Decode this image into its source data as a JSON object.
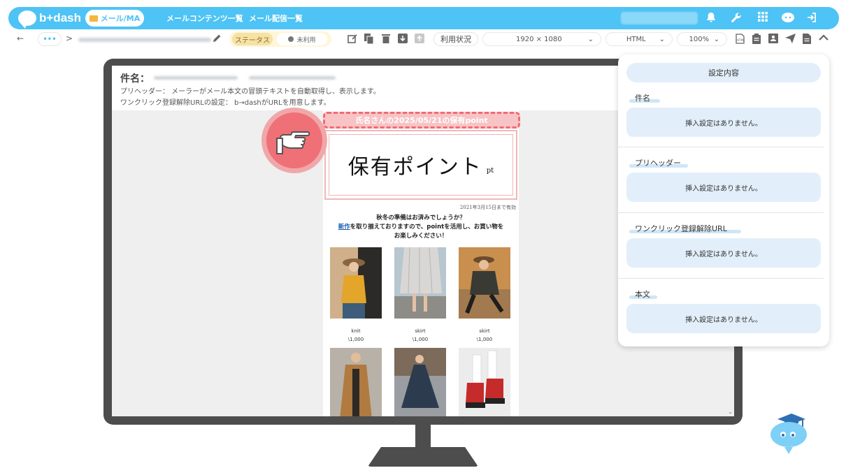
{
  "header": {
    "logo_text": "b+dash",
    "mode_label": "メール/MA",
    "nav": [
      "メールコンテンツ一覧",
      "メール配信一覧"
    ]
  },
  "toolbar": {
    "status_label": "ステータス",
    "status_value": "未利用",
    "usage_label": "利用状況",
    "resolution": "1920 × 1080",
    "format": "HTML",
    "zoom": "100%",
    "more_label": "•••"
  },
  "mail_header": {
    "subject_label": "件名：",
    "preheader_line": "プリヘッダー： メーラーがメール本文の冒頭テキストを自動取得し、表示します。",
    "unsubscribe_line": "ワンクリック登録解除URLの設定： b→dashがURLを用意します。"
  },
  "email": {
    "banner_text": "氏名さんの2025/05/21の保有point",
    "points_text": "保有ポイント",
    "points_unit": "pt",
    "valid_until": "2021年3月15日まで有効",
    "intro_line1": "秋冬の準備はお済みでしょうか？",
    "intro_link": "新作",
    "intro_line2_rest": "を取り揃えておりますので、pointを活用し、お買い物を",
    "intro_line3": "お楽しみください！",
    "products": [
      {
        "name": "knit",
        "price": "\\1,000"
      },
      {
        "name": "skirt",
        "price": "\\1,000"
      },
      {
        "name": "skirt",
        "price": "\\1,000"
      }
    ]
  },
  "panel": {
    "title": "設定内容",
    "sections": [
      {
        "label": "件名",
        "value": "挿入設定はありません。"
      },
      {
        "label": "プリヘッダー",
        "value": "挿入設定はありません。"
      },
      {
        "label": "ワンクリック登録解除URL",
        "value": "挿入設定はありません。"
      },
      {
        "label": "本文",
        "value": "挿入設定はありません。"
      }
    ]
  },
  "colors": {
    "header_bg": "#4ec3f5",
    "banner_pink": "#f7c3c5",
    "banner_dash": "#ef6b74",
    "panel_box": "#e2effa",
    "monitor": "#4d4d4d"
  }
}
